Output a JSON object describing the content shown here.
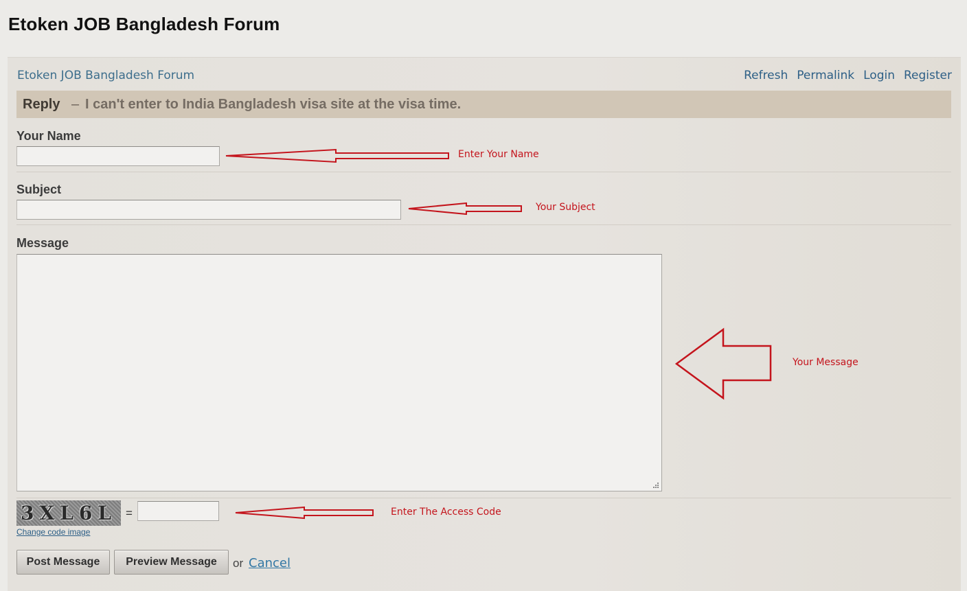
{
  "page": {
    "title": "Etoken JOB Bangladesh Forum"
  },
  "nav": {
    "breadcrumb": "Etoken JOB Bangladesh Forum",
    "links": {
      "refresh": "Refresh",
      "permalink": "Permalink",
      "login": "Login",
      "register": "Register"
    }
  },
  "reply": {
    "label": "Reply",
    "separator": "–",
    "subject": "I can't enter to India Bangladesh visa site at the visa time."
  },
  "form": {
    "name_label": "Your Name",
    "name_value": "",
    "subject_label": "Subject",
    "subject_value": "",
    "message_label": "Message",
    "message_value": "",
    "captcha_text": "3XL6L",
    "captcha_equals": "=",
    "access_code_value": "",
    "change_code_label": "Change code image",
    "post_button": "Post Message",
    "preview_button": "Preview Message",
    "or_text": "or",
    "cancel_link": "Cancel"
  },
  "annotations": {
    "name": "Enter Your Name",
    "subject": "Your Subject",
    "message": "Your Message",
    "access_code": "Enter The Access Code",
    "color": "#c4141c"
  }
}
